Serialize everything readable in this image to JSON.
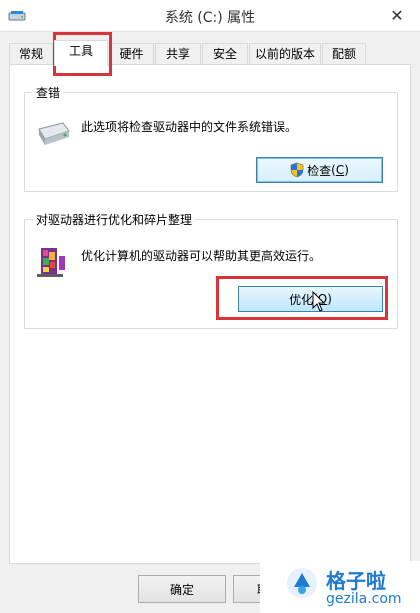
{
  "window": {
    "title": "系统 (C:) 属性",
    "close_glyph": "✕"
  },
  "tabs": [
    {
      "label": "常规",
      "active": false
    },
    {
      "label": "工具",
      "active": true
    },
    {
      "label": "硬件",
      "active": false
    },
    {
      "label": "共享",
      "active": false
    },
    {
      "label": "安全",
      "active": false
    },
    {
      "label": "以前的版本",
      "active": false
    },
    {
      "label": "配额",
      "active": false
    }
  ],
  "error_check": {
    "group_title": "查错",
    "description": "此选项将检查驱动器中的文件系统错误。",
    "button_label": "检查",
    "button_accel": "C",
    "icon": "drive-icon",
    "button_icon": "uac-shield-icon"
  },
  "optimize": {
    "group_title": "对驱动器进行优化和碎片整理",
    "description": "优化计算机的驱动器可以帮助其更高效运行。",
    "button_label": "优化",
    "button_accel": "O",
    "icon": "defrag-icon"
  },
  "footer": {
    "ok_label": "确定",
    "cancel_label": "取"
  },
  "watermark": {
    "main": "格子啦",
    "sub": "gezila.com"
  },
  "colors": {
    "highlight": "#d9343a",
    "accent": "#1f7ad1"
  }
}
